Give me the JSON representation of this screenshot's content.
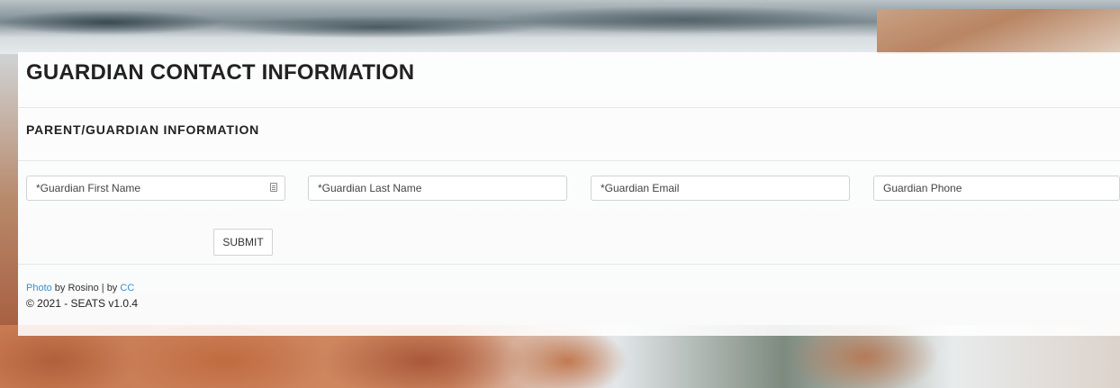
{
  "page": {
    "title": "GUARDIAN CONTACT INFORMATION",
    "section_title": "PARENT/GUARDIAN INFORMATION"
  },
  "form": {
    "first_name_placeholder": "*Guardian First Name",
    "last_name_placeholder": "*Guardian Last Name",
    "email_placeholder": "*Guardian Email",
    "phone_placeholder": "Guardian Phone",
    "submit_label": "SUBMIT"
  },
  "footer": {
    "photo_link": "Photo",
    "by_text": " by Rosino | by ",
    "license_link": "CC",
    "copyright": "© 2021 - SEATS v1.0.4"
  },
  "colors": {
    "link": "#3a8fd1",
    "text": "#222222"
  }
}
